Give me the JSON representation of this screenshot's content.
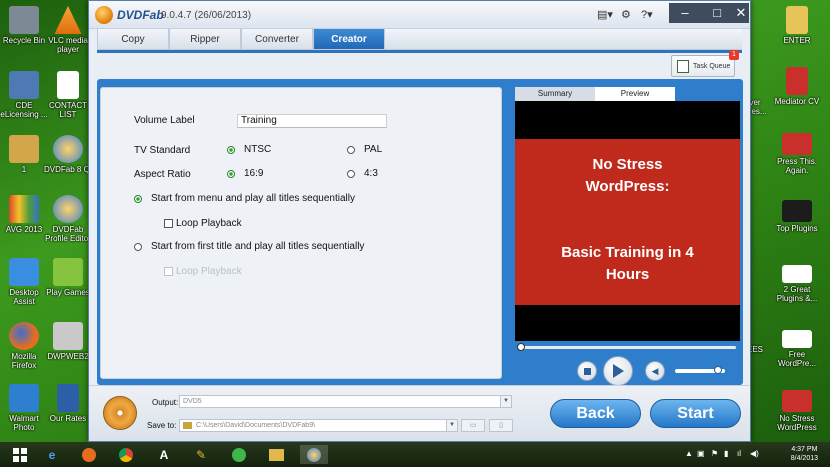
{
  "desktop_left": [
    {
      "label": "Recycle Bin",
      "color": "#7d8a96"
    },
    {
      "label": "VLC media player",
      "color": "#f28c18"
    },
    {
      "label": "CDE eLicensing ...",
      "color": "#4e79b4"
    },
    {
      "label": "CONTACT LIST",
      "color": "#ffffff"
    },
    {
      "label": "1",
      "color": "#d4a64b"
    },
    {
      "label": "DVDFab 8 Qt",
      "color": "#3d7fd0"
    },
    {
      "label": "AVG 2013",
      "color": "#d8492c"
    },
    {
      "label": "DVDFab Profile Editor",
      "color": "#3d7fd0"
    },
    {
      "label": "Desktop Assist",
      "color": "#3a8ee0"
    },
    {
      "label": "Play Games",
      "color": "#86c33f"
    },
    {
      "label": "Mozilla Firefox",
      "color": "#e66d1f"
    },
    {
      "label": "DWPWEB2",
      "color": "#c9c9c9"
    },
    {
      "label": "Walmart Photo",
      "color": "#2f7fd1"
    },
    {
      "label": "Our Rates",
      "color": "#2c5fa8"
    }
  ],
  "desktop_right": [
    {
      "label": "ENTER",
      "color": "#e7c45a"
    },
    {
      "label": "ver Pres...",
      "color": "#ffffff"
    },
    {
      "label": "Mediator CV",
      "color": "#c9302c"
    },
    {
      "label": "Press This. Again.",
      "color": "#c9302c"
    },
    {
      "label": "Top Plugins",
      "color": "#1c1c1c"
    },
    {
      "label": "2 Great Plugins &...",
      "color": "#ffffff"
    },
    {
      "label": "EES",
      "color": "#ffffff"
    },
    {
      "label": "Free WordPre...",
      "color": "#ffffff"
    },
    {
      "label": "No Stress WordPress",
      "color": "#c9302c"
    }
  ],
  "window": {
    "brand": "DVDFab",
    "version": "9.0.4.7 (26/06/2013)",
    "tabs": [
      "Copy",
      "Ripper",
      "Converter",
      "Creator"
    ],
    "active_tab": "Creator",
    "task_queue": {
      "label": "Task Queue",
      "badge": "1"
    }
  },
  "settings": {
    "volume_label": {
      "label": "Volume Label",
      "value": "Training"
    },
    "tv_standard": {
      "label": "TV Standard",
      "opt1": "NTSC",
      "opt2": "PAL",
      "selected": "NTSC"
    },
    "aspect_ratio": {
      "label": "Aspect Ratio",
      "opt1": "16:9",
      "opt2": "4:3",
      "selected": "16:9"
    },
    "mode1": {
      "label": "Start from menu and play all titles sequentially",
      "selected": true
    },
    "mode1_loop": "Loop Playback",
    "mode2": {
      "label": "Start from first title and play all titles sequentially",
      "selected": false
    },
    "mode2_loop": "Loop Playback"
  },
  "preview": {
    "tabs": [
      "Summary",
      "Preview"
    ],
    "active_tab": "Preview",
    "title_line1": "No Stress",
    "title_line2": "WordPress:",
    "subtitle_line1": "Basic Training in 4",
    "subtitle_line2": "Hours",
    "seek_progress": 0,
    "volume_level": 0.85
  },
  "bottom": {
    "output_label": "Output:",
    "output_value": "DVD5",
    "saveto_label": "Save to:",
    "saveto_value": "C:\\Users\\David\\Documents\\DVDFab9\\",
    "back_label": "Back",
    "start_label": "Start"
  },
  "taskbar": {
    "time": "4:37 PM",
    "date": "8/4/2013"
  }
}
